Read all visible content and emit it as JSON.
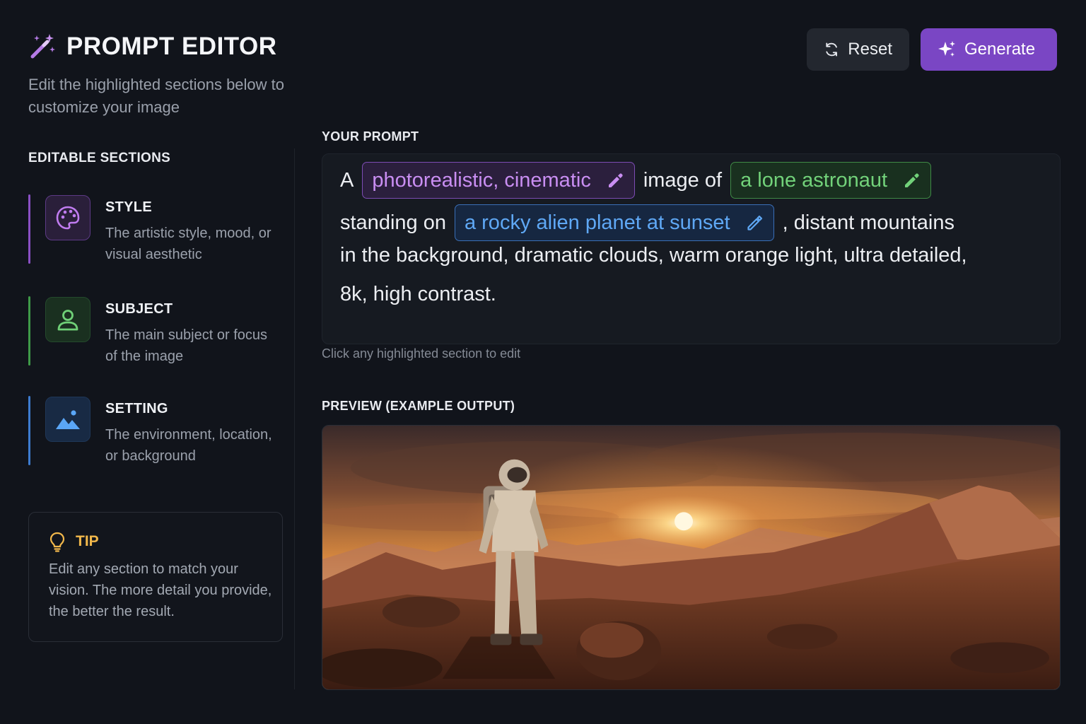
{
  "app": {
    "title": "PROMPT EDITOR",
    "subtitle": "Edit the highlighted sections below to customize your image"
  },
  "toolbar": {
    "reset_label": "Reset",
    "generate_label": "Generate"
  },
  "sidebar": {
    "heading": "EDITABLE SECTIONS",
    "items": [
      {
        "label": "STYLE",
        "description": "The artistic style, mood, or visual aesthetic",
        "icon": "palette-icon",
        "color": "#a864e0"
      },
      {
        "label": "SUBJECT",
        "description": "The main subject or focus of the image",
        "icon": "person-icon",
        "color": "#4fb85a"
      },
      {
        "label": "SETTING",
        "description": "The environment, location, or background",
        "icon": "landscape-icon",
        "color": "#4a90e2"
      }
    ],
    "tip": {
      "title": "TIP",
      "text": "Edit any section to match your vision. The more detail you provide, the better the result."
    }
  },
  "prompt": {
    "label": "YOUR PROMPT",
    "text_a": "A",
    "style": "photorealistic, cinematic",
    "text_image_of": "image of",
    "subject": "a lone astronaut",
    "text_standing_on": "standing on",
    "setting": "a rocky alien planet at sunset",
    "text_after_setting": ", distant mountains",
    "line3": "in the background, dramatic clouds, warm orange light, ultra detailed,",
    "line4": "8k, high contrast.",
    "hint": "Click any highlighted section to edit"
  },
  "preview": {
    "label": "PREVIEW (EXAMPLE OUTPUT)"
  },
  "colors": {
    "accent": "#7a46c4",
    "style": "#c98ef2",
    "subject": "#72d27a",
    "setting": "#5fa8f5",
    "tip": "#f2b84b"
  }
}
